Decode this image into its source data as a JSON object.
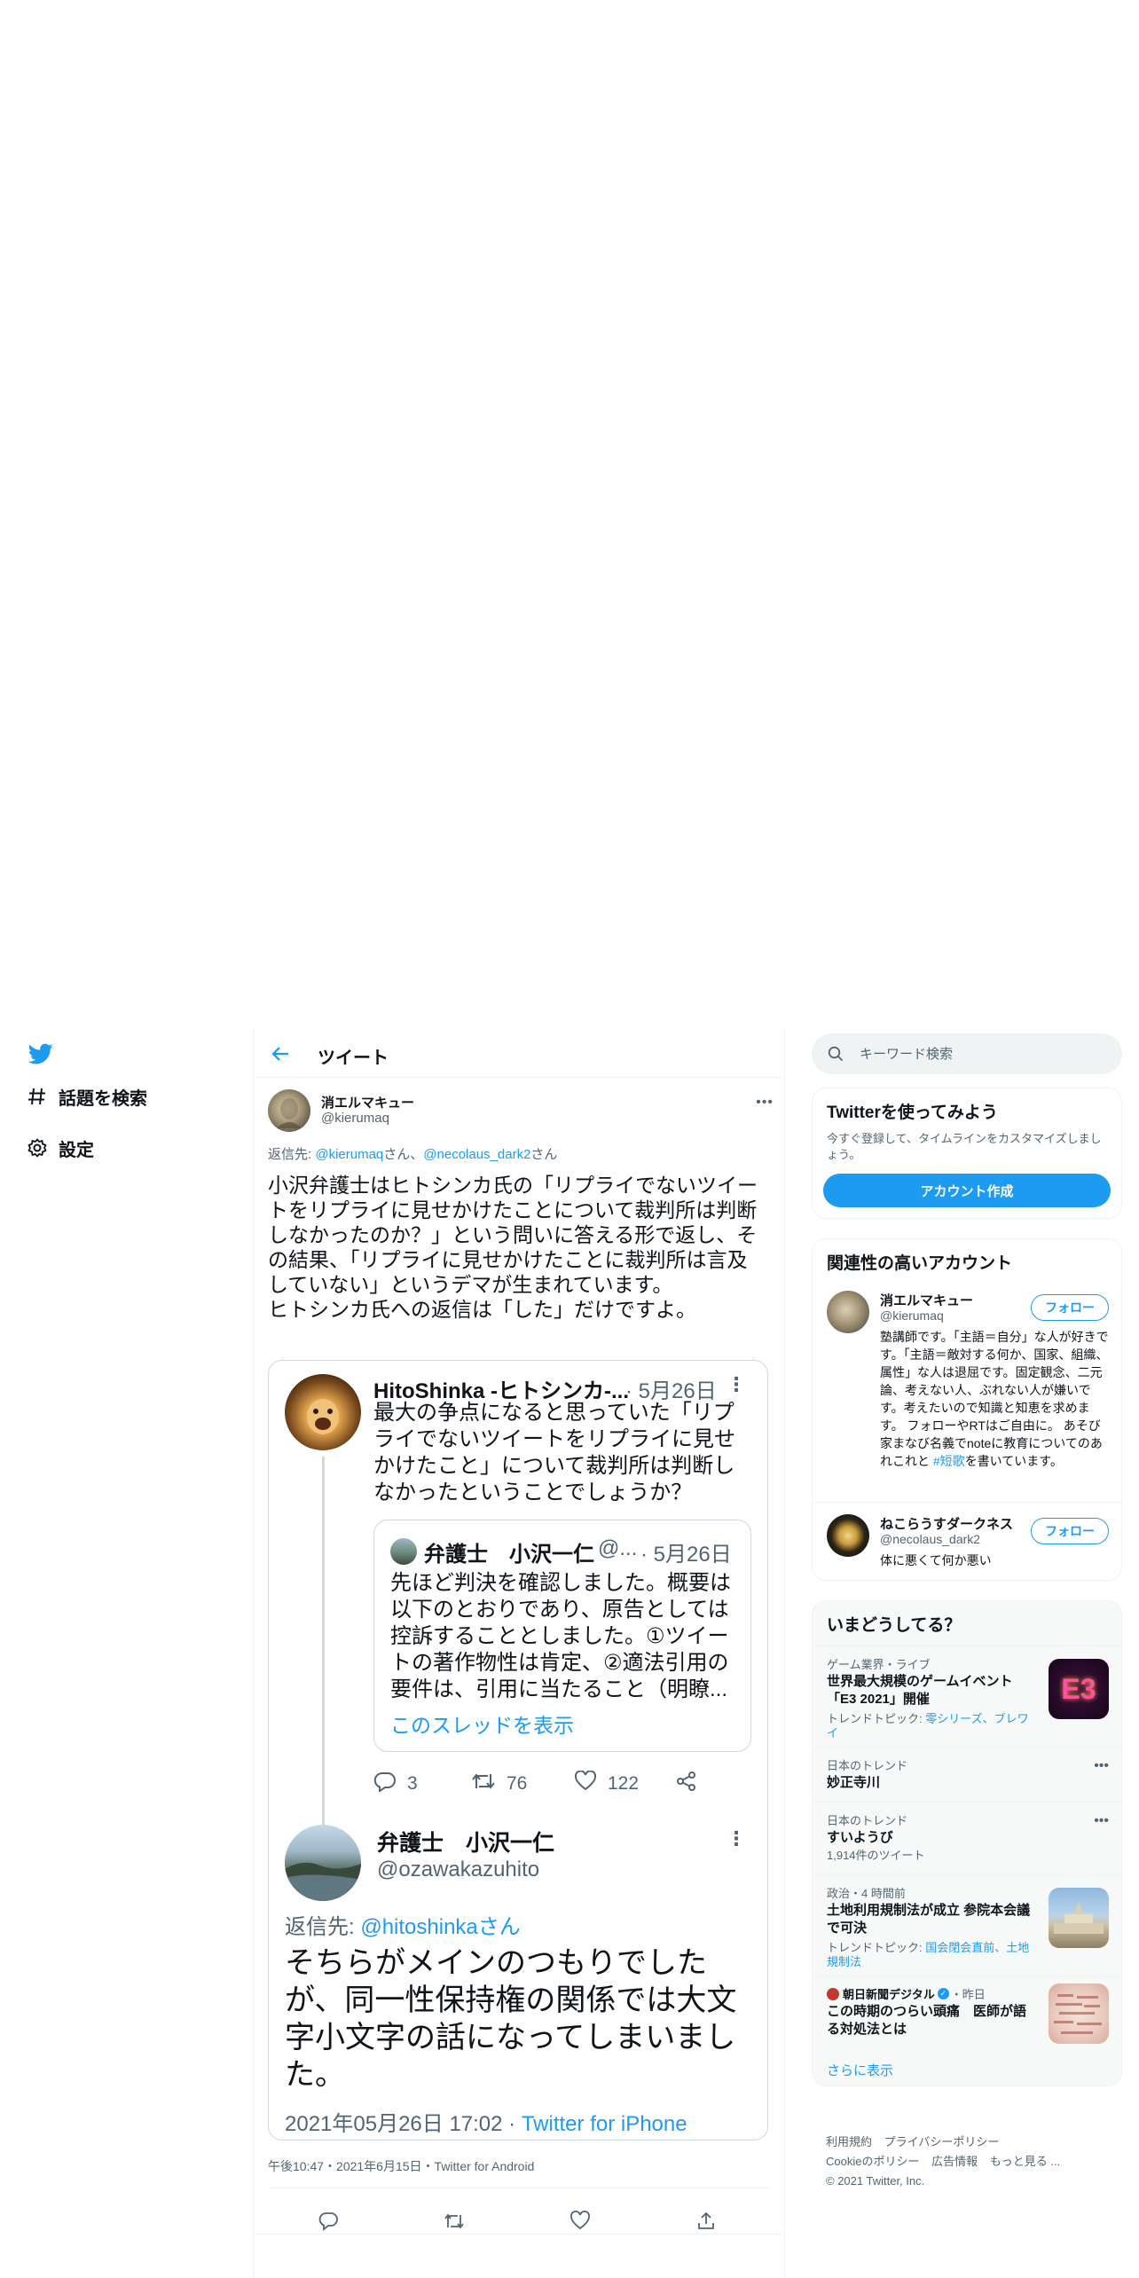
{
  "nav": {
    "explore": "話題を検索",
    "settings": "設定"
  },
  "header": {
    "title": "ツイート"
  },
  "tweet": {
    "author_name": "消エルマキュー",
    "author_handle": "@kierumaq",
    "reply_prefix": "返信先: ",
    "reply_user1": "@kierumaq",
    "reply_san1": "さん、",
    "reply_user2": "@necolaus_dark2",
    "reply_san2": "さん",
    "text": "小沢弁護士はヒトシンカ氏の「リプライでないツイートをリプライに見せかけたことについて裁判所は判断しなかったのか？」という問いに答える形で返し、その結果、「リプライに見せかけたことに裁判所は言及していない」というデマが生まれています。\nヒトシンカ氏への返信は「した」だけですよ。",
    "meta": "午後10:47・2021年6月15日・Twitter for Android"
  },
  "embed": {
    "first": {
      "name": "HitoShinka -ヒトシンカ-...",
      "date": "· 5月26日",
      "text": "最大の争点になると思っていた「リプライでないツイートをリプライに見せかけたこと」について裁判所は判断しなかったということでしょうか？"
    },
    "inner": {
      "name": "弁護士　小沢一仁",
      "handle": "@...",
      "date": "· 5月26日",
      "text": "先ほど判決を確認しました。概要は以下のとおりであり、原告としては控訴することとしました。①ツイートの著作物性は肯定、②適法引用の要件は、引用に当たること（明瞭...",
      "show_thread": "このスレッドを表示"
    },
    "actions": {
      "replies": "3",
      "retweets": "76",
      "likes": "122"
    },
    "second": {
      "name": "弁護士　小沢一仁",
      "handle": "@ozawakazuhito",
      "replyto_prefix": "返信先: ",
      "replyto_user": "@hitoshinkaさん",
      "text": "そちらがメインのつもりでしたが、同一性保持権の関係では大文字小文字の話になってしまいました。",
      "date": "2021年05月26日 17:02 · ",
      "source": "Twitter for iPhone"
    }
  },
  "search": {
    "placeholder": "キーワード検索"
  },
  "signup": {
    "title": "Twitterを使ってみよう",
    "desc": "今すぐ登録して、タイムラインをカスタマイズしましょう。",
    "button": "アカウント作成"
  },
  "related": {
    "title": "関連性の高いアカウント",
    "follow_label": "フォロー",
    "accounts": [
      {
        "name": "消エルマキュー",
        "handle": "@kierumaq",
        "bio": "塾講師です。「主語＝自分」な人が好きです。「主語＝敵対する何か、国家、組織、属性」な人は退屈です。固定観念、二元論、考えない人、ぶれない人が嫌いです。考えたいので知識と知恵を求めます。 フォローやRTはご自由に。 あそび家まなび名義でnoteに教育についてのあれこれと ",
        "bio_tag": "#短歌",
        "bio_end": "を書いています。"
      },
      {
        "name": "ねこらうすダークネス",
        "handle": "@necolaus_dark2",
        "bio": "体に悪くて何か悪い"
      }
    ]
  },
  "trends": {
    "title": "いまどうしてる？",
    "items": [
      {
        "context": "ゲーム業界・ライブ",
        "title": "世界最大規模のゲームイベント「E3 2021」開催",
        "sub_prefix": "トレンドトピック: ",
        "sub_link": "零シリーズ、ブレワイ",
        "thumb_text": "E3"
      },
      {
        "context": "日本のトレンド",
        "title": "妙正寺川"
      },
      {
        "context": "日本のトレンド",
        "title": "すいようび",
        "sub": "1,914件のツイート"
      },
      {
        "context": "政治・4 時間前",
        "title": "土地利用規制法が成立 参院本会議で可決",
        "sub_prefix": "トレンドトピック: ",
        "sub_link": "国会閉会直前、土地規制法"
      },
      {
        "context_source": "朝日新聞デジタル",
        "context_time": "・昨日",
        "title": "この時期のつらい頭痛　医師が語る対処法とは"
      }
    ],
    "show_more": "さらに表示"
  },
  "footer": {
    "links": [
      "利用規約",
      "プライバシーポリシー",
      "Cookieのポリシー",
      "広告情報",
      "もっと見る ..."
    ],
    "copyright": "© 2021 Twitter, Inc."
  },
  "colors": {
    "accent": "#1d9bf0",
    "text": "#0f1419",
    "secondary": "#536471",
    "border": "#eff3f4"
  }
}
